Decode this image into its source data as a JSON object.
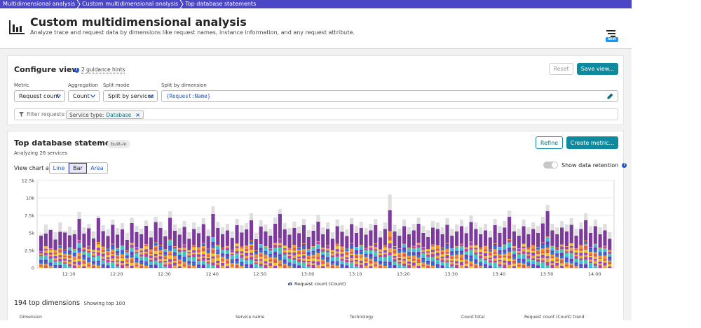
{
  "breadcrumb": [
    "Multidimensional analysis",
    "Custom multidimensional analysis",
    "Top database statements"
  ],
  "header": {
    "title": "Custom multidimensional analysis",
    "subtitle": "Analyze trace and request data by dimensions like request names, instance information, and any request attribute.",
    "badge": "NEW"
  },
  "configure": {
    "title": "Configure view",
    "hints": "2 guidance hints",
    "reset_label": "Reset",
    "save_label": "Save view...",
    "metric": {
      "label": "Metric",
      "value": "Request count"
    },
    "aggregation": {
      "label": "Aggregation",
      "value": "Count"
    },
    "split_mode": {
      "label": "Split mode",
      "value": "Split by services"
    },
    "dimension": {
      "label": "Split by dimension",
      "value": "{Request:Name}"
    },
    "filter": {
      "label": "Filter requests:",
      "chip_key": "Service type:",
      "chip_value": "Database"
    }
  },
  "statements": {
    "title": "Top database statements",
    "badge": "built-in",
    "analyzing": "Analyzing 26 services",
    "refine_label": "Refine",
    "create_label": "Create metric...",
    "view_as": "View chart as:",
    "modes": [
      "Line",
      "Bar",
      "Area"
    ],
    "active_mode": "Bar",
    "retention_label": "Show data retention",
    "dimension_count": "194 top dimensions",
    "showing": "Showing top 100",
    "column_headers": [
      "Dimension",
      "Service name",
      "Technology",
      "Count total",
      "Request count (Count) trend"
    ]
  },
  "chart_data": {
    "type": "bar",
    "stacked": true,
    "ylim": [
      0,
      12500
    ],
    "y_ticks": [
      "0",
      "2.5k",
      "5k",
      "7.5k",
      "10k",
      "12.5k"
    ],
    "x_ticks": [
      "12:10",
      "12:20",
      "12:30",
      "12:40",
      "12:50",
      "13:00",
      "13:10",
      "13:20",
      "13:30",
      "13:40",
      "13:50",
      "14:00"
    ],
    "legend": "Request count (Count)",
    "grid": true,
    "bar_count": 120,
    "layer_colors": [
      "#7c3a9c",
      "#f0c51a",
      "#e15a43",
      "#f28f2c",
      "#2f6dd6",
      "#6a3bb8",
      "#3fb5e8",
      "#3fc9a5",
      "#b93fa1",
      "#e6a43b",
      "#9f42b4"
    ],
    "purple_tops": [
      2200,
      1800,
      2600,
      1500,
      1900,
      2400,
      1700,
      2100,
      3000,
      2000,
      2500,
      1600,
      3400,
      2200,
      1800,
      2700,
      1900,
      2300,
      1500,
      2800,
      2100,
      2000,
      2600,
      1700,
      2900,
      2400,
      1800,
      3100,
      2200,
      1900,
      2500,
      1600,
      2300,
      2000,
      2700,
      1800,
      3300,
      2400,
      1900,
      2200,
      1700,
      2600,
      2000,
      2300,
      2900,
      1600,
      2500,
      2100,
      1800,
      2700,
      3500,
      2300,
      1900,
      2400,
      2000,
      2600,
      1700,
      2200,
      2800,
      1900,
      2300,
      1600,
      2500,
      2100,
      1800,
      2700,
      2000,
      2400,
      1900,
      2200,
      2600,
      1700,
      2300,
      3000,
      2100,
      1800,
      2500,
      1900,
      2200,
      2700,
      2000,
      1700,
      2400,
      2300,
      1900,
      2600,
      1800,
      2100,
      2500,
      2000,
      2800,
      2300,
      1900,
      2200,
      1700,
      2600,
      2000,
      2400,
      3200,
      2100,
      1800,
      2500,
      1900,
      2300,
      2000,
      2700,
      3600,
      2200,
      1900,
      2400,
      2100,
      2600,
      1800,
      2300,
      2900,
      2000,
      2500,
      1900,
      2200,
      1600
    ],
    "totals": [
      4800,
      6200,
      5600,
      5100,
      6500,
      5300,
      5900,
      5400,
      8000,
      5800,
      6300,
      5200,
      7400,
      6100,
      5500,
      6900,
      5700,
      6400,
      5000,
      7200,
      6000,
      5600,
      6800,
      5300,
      7300,
      6600,
      5400,
      8100,
      6200,
      5700,
      6700,
      5100,
      6500,
      5900,
      7100,
      5500,
      8800,
      6600,
      5800,
      6300,
      5200,
      7000,
      6100,
      6400,
      7800,
      5000,
      6800,
      6200,
      5600,
      7200,
      8400,
      6400,
      5700,
      6600,
      5900,
      7000,
      5400,
      6200,
      7600,
      5800,
      6500,
      5100,
      6900,
      6100,
      5500,
      7100,
      6000,
      6600,
      5700,
      6300,
      7000,
      5300,
      6500,
      10500,
      6200,
      5600,
      6900,
      5800,
      6300,
      7200,
      6000,
      5400,
      6700,
      6500,
      5800,
      7100,
      5600,
      6200,
      6900,
      5900,
      7500,
      6500,
      5800,
      6300,
      5300,
      7000,
      6000,
      6700,
      8200,
      6200,
      5600,
      6900,
      5800,
      6500,
      6000,
      7300,
      9000,
      6300,
      5800,
      6700,
      6200,
      7100,
      5600,
      6500,
      7800,
      6000,
      6900,
      5800,
      6300,
      5100
    ]
  }
}
